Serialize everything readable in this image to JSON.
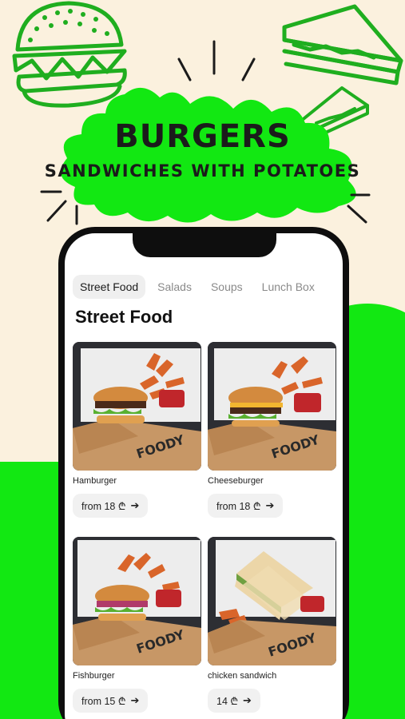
{
  "headline": {
    "title": "BURGERS",
    "subtitle": "SANDWICHES WITH POTATOES"
  },
  "tabs": [
    {
      "label": "Street Food",
      "active": true
    },
    {
      "label": "Salads",
      "active": false
    },
    {
      "label": "Soups",
      "active": false
    },
    {
      "label": "Lunch Box",
      "active": false
    }
  ],
  "section_title": "Street Food",
  "products": [
    {
      "name": "Hamburger",
      "price": "from 18 ₾",
      "image": "hamburger-box-with-potato-wedges"
    },
    {
      "name": "Cheeseburger",
      "price": "from 18 ₾",
      "image": "cheeseburger-box-with-potato-wedges"
    },
    {
      "name": "Fishburger",
      "price": "from 15 ₾",
      "image": "fishburger-box-with-potato-wedges"
    },
    {
      "name": "chicken sandwich",
      "price": "14 ₾",
      "image": "chicken-sandwich-box-with-potato-wedges"
    }
  ],
  "brand_on_box": "FOODY",
  "colors": {
    "background": "#fbf1de",
    "accent_green": "#12e812",
    "line_art": "#1fae1f"
  },
  "icons": [
    "burger-line-icon",
    "sandwich-line-icon",
    "arrow-right-icon"
  ]
}
